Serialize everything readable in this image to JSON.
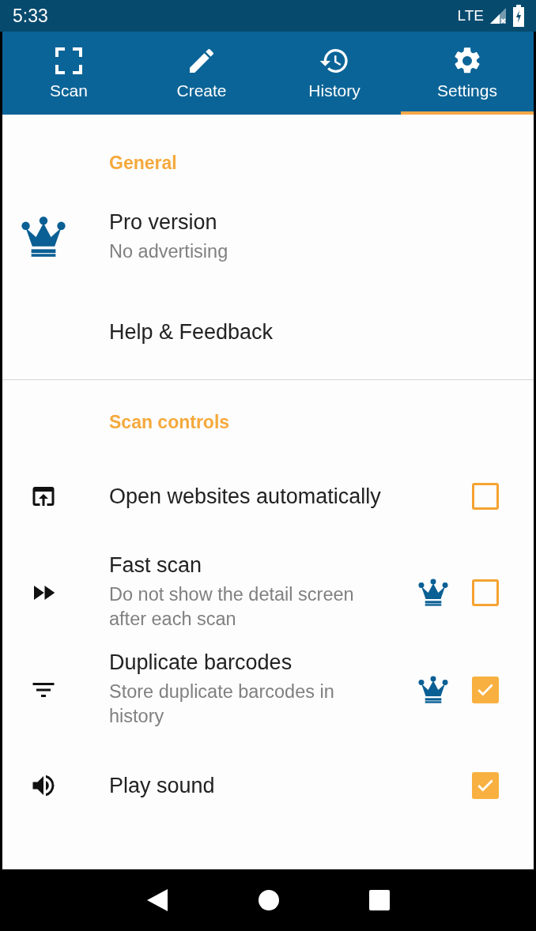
{
  "status_bar": {
    "time": "5:33",
    "network": "LTE"
  },
  "tabs": [
    {
      "label": "Scan",
      "selected": false
    },
    {
      "label": "Create",
      "selected": false
    },
    {
      "label": "History",
      "selected": false
    },
    {
      "label": "Settings",
      "selected": true
    }
  ],
  "sections": [
    {
      "title": "General",
      "items": [
        {
          "kind": "plain",
          "title": "Pro version",
          "subtitle": "No advertising"
        },
        {
          "kind": "plain",
          "title": "Help & Feedback"
        }
      ]
    },
    {
      "title": "Scan controls",
      "items": [
        {
          "kind": "checkbox",
          "title": "Open websites automatically",
          "pro": false,
          "checked": false
        },
        {
          "kind": "checkbox",
          "title": "Fast scan",
          "subtitle": "Do not show the detail screen after each scan",
          "pro": true,
          "checked": false
        },
        {
          "kind": "checkbox",
          "title": "Duplicate barcodes",
          "subtitle": "Store duplicate barcodes in history",
          "pro": true,
          "checked": true
        },
        {
          "kind": "checkbox",
          "title": "Play sound",
          "pro": false,
          "checked": true
        }
      ]
    }
  ]
}
